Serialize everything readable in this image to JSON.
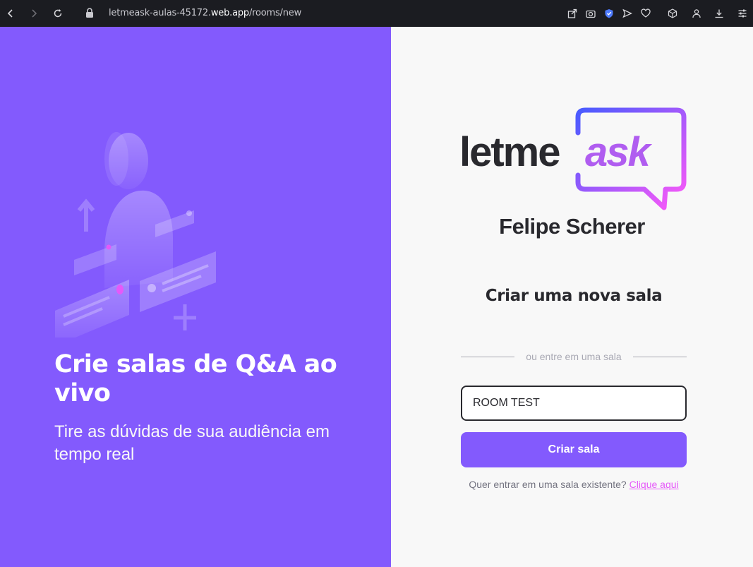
{
  "browser": {
    "url_prefix": "letmeask-aulas-45172.",
    "url_host": "web.app",
    "url_path": "/rooms/new"
  },
  "aside": {
    "title": "Crie salas de Q&A ao vivo",
    "subtitle": "Tire as dúvidas de sua audiência em tempo real"
  },
  "main": {
    "logo_letme": "letme",
    "logo_ask": "ask",
    "user_name": "Felipe Scherer",
    "form_title": "Criar uma nova sala",
    "separator_text": "ou entre em uma sala",
    "room_input_value": "ROOM TEST",
    "create_button": "Criar sala",
    "join_prompt": "Quer entrar em uma sala existente?",
    "join_link": "Clique aqui"
  },
  "colors": {
    "purple": "#835afd",
    "pink": "#e559f9",
    "dark": "#29292e",
    "browser_bg": "#1b1c21"
  }
}
